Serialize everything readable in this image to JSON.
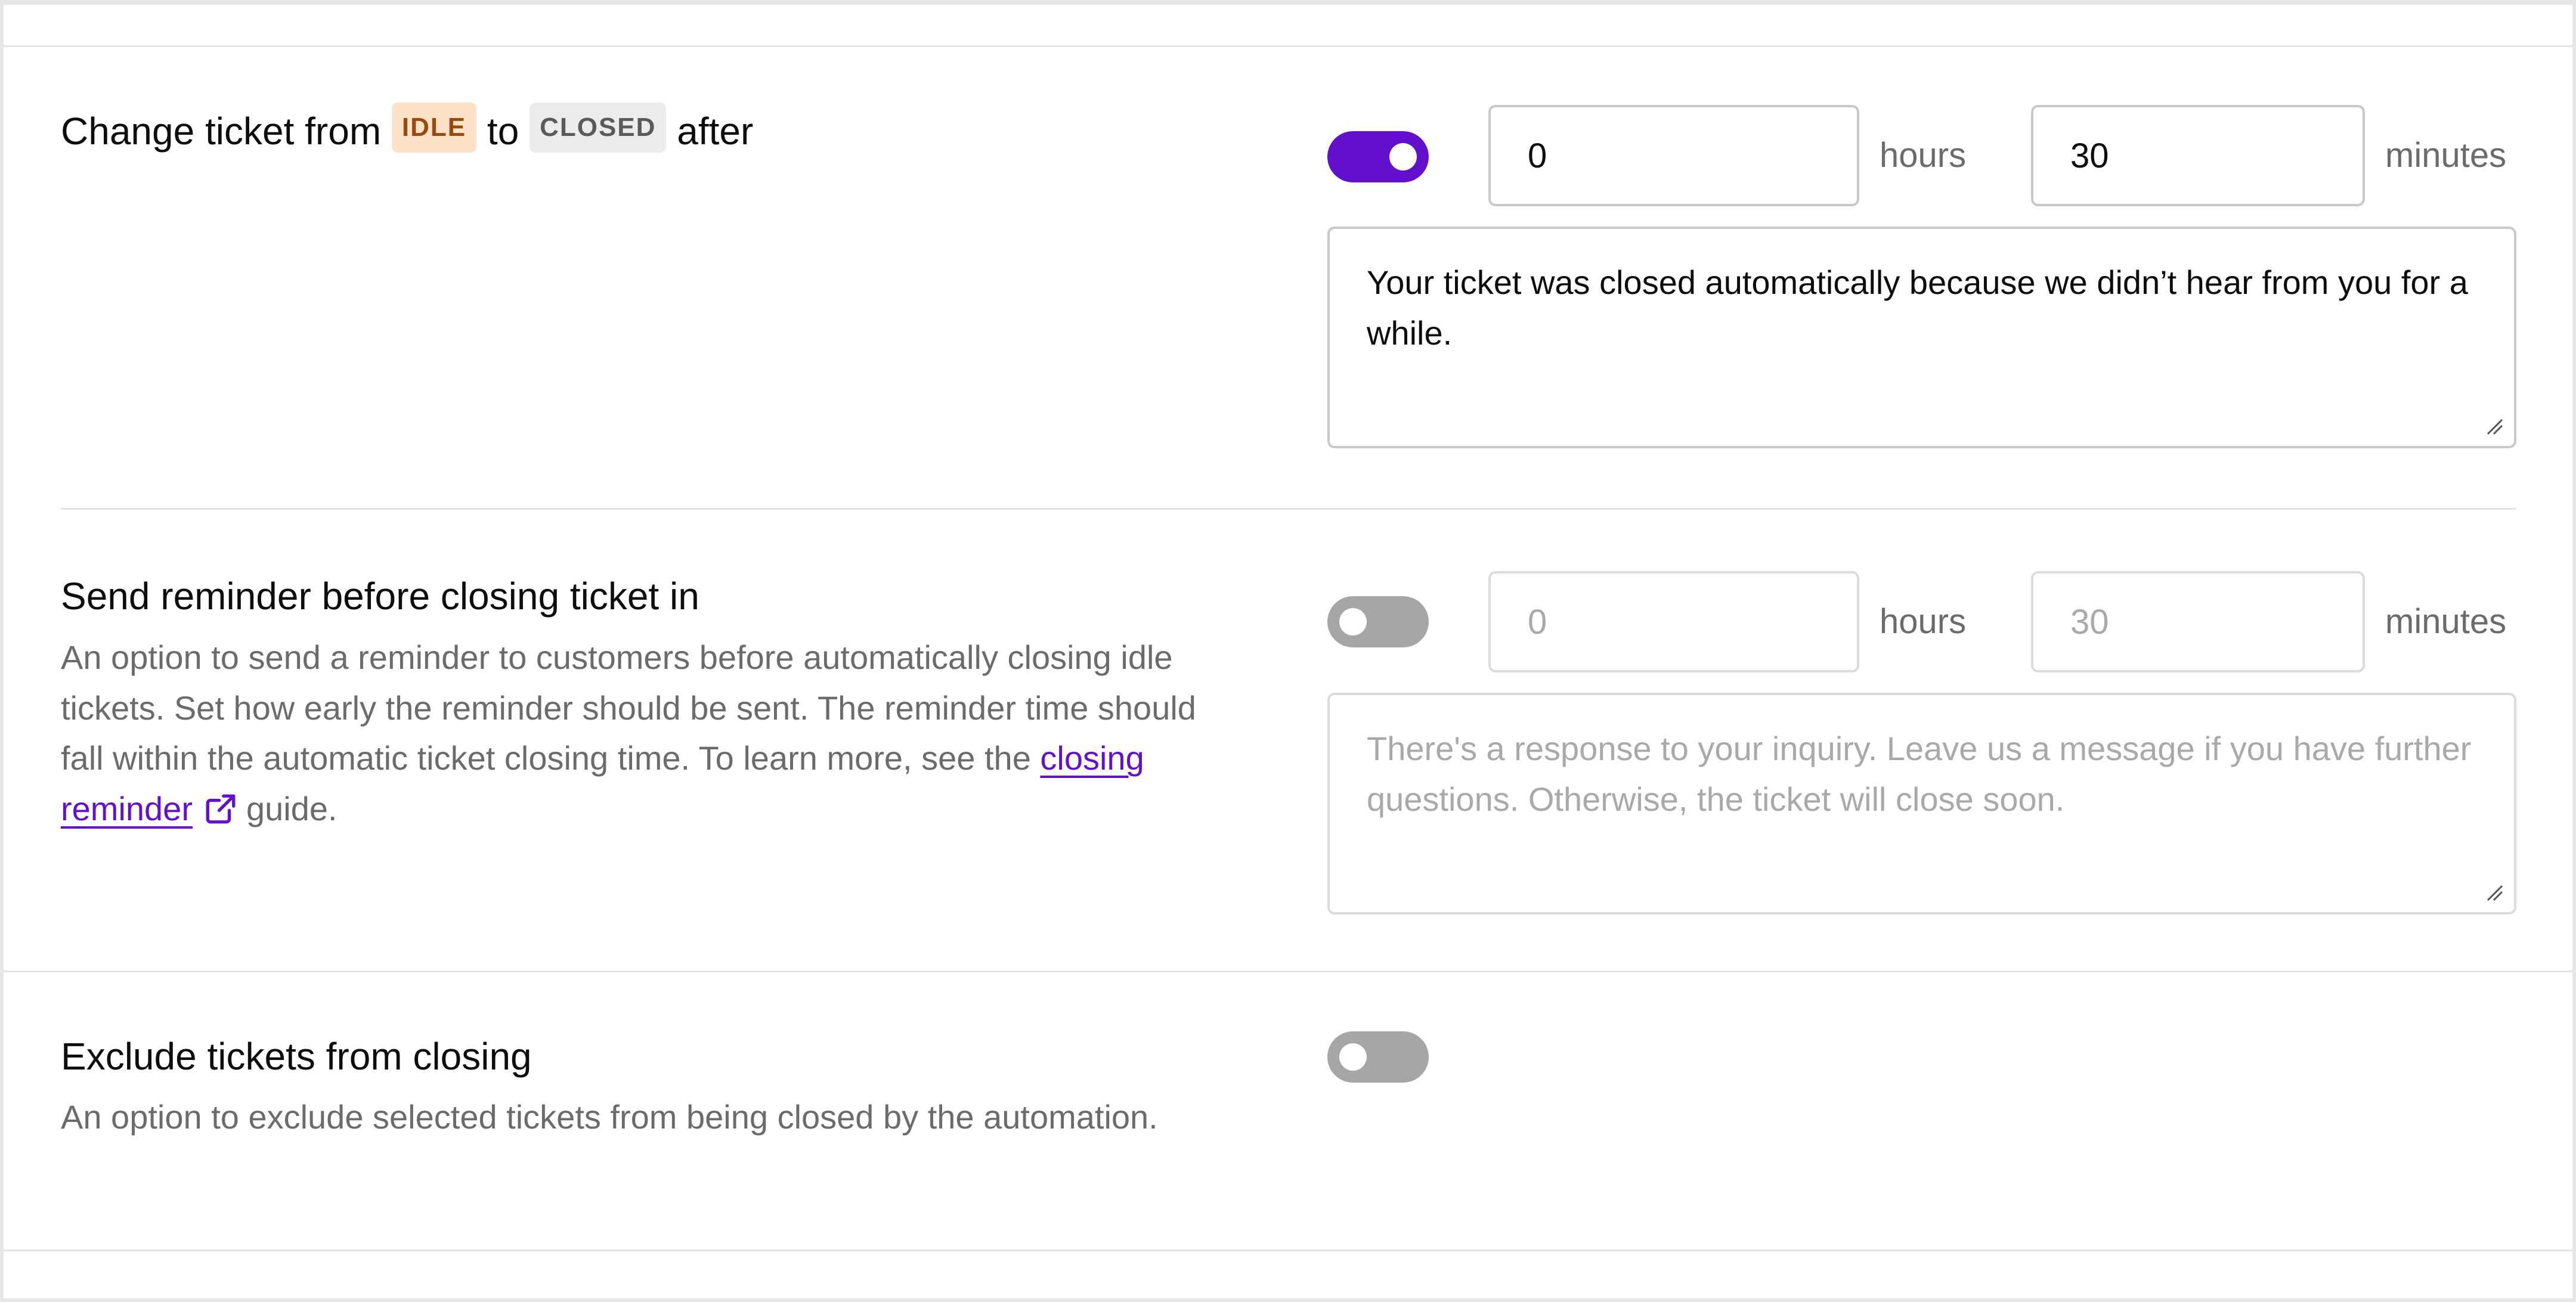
{
  "idle_to_closed": {
    "title_prefix": "Change ticket from",
    "from_badge": "IDLE",
    "title_middle": "to",
    "to_badge": "CLOSED",
    "title_suffix": "after",
    "enabled": true,
    "hours_value": "0",
    "hours_unit": "hours",
    "minutes_value": "30",
    "minutes_unit": "minutes",
    "message": "Your ticket was closed automatically because we didn’t hear from you for a while."
  },
  "reminder": {
    "title": "Send reminder before closing ticket in",
    "description_before_link": "An option to send a reminder to customers before automatically closing idle tickets. Set how early the reminder should be sent. The reminder time should fall within the automatic ticket closing time. To learn more, see the",
    "link_text": "closing reminder",
    "description_after_link": "guide.",
    "enabled": false,
    "hours_placeholder": "0",
    "hours_unit": "hours",
    "minutes_placeholder": "30",
    "minutes_unit": "minutes",
    "message_placeholder": "There's a response to your inquiry. Leave us a message if you have further questions. Otherwise, the ticket will close soon."
  },
  "exclude": {
    "title": "Exclude tickets from closing",
    "description": "An option to exclude selected tickets from being closed by the automation.",
    "enabled": false
  },
  "colors": {
    "accent": "#6210cc",
    "idle_badge_bg": "#fee2c7",
    "idle_badge_text": "#9a4a10",
    "closed_badge_bg": "#ececec",
    "toggle_off": "#a6a6a6"
  }
}
